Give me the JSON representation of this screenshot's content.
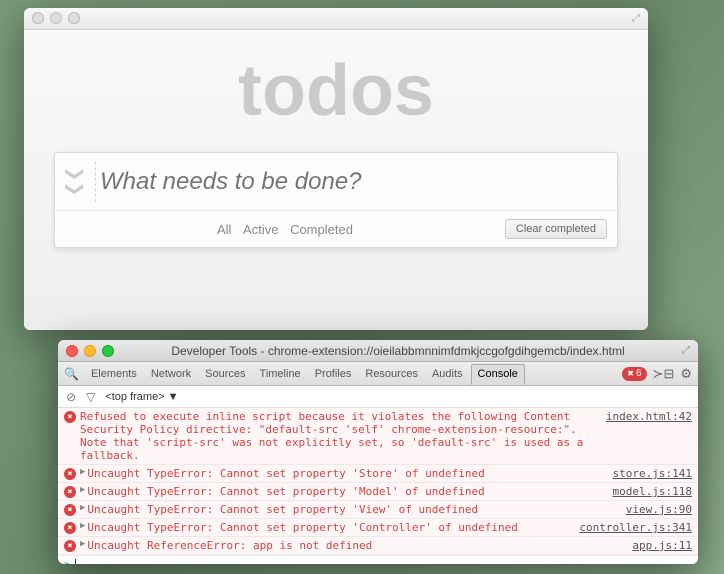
{
  "app": {
    "title": "todos",
    "placeholder": "What needs to be done?",
    "filters": {
      "all": "All",
      "active": "Active",
      "completed": "Completed"
    },
    "clear_label": "Clear completed"
  },
  "devtools": {
    "window_title": "Developer Tools - chrome-extension://oieilabbmnnimfdmkjccgofgdihgemcb/index.html",
    "tabs": {
      "elements": "Elements",
      "network": "Network",
      "sources": "Sources",
      "timeline": "Timeline",
      "profiles": "Profiles",
      "resources": "Resources",
      "audits": "Audits",
      "console": "Console"
    },
    "error_count": "6",
    "frame_selector": "<top frame> ▼",
    "errors": [
      {
        "msg": "Refused to execute inline script because it violates the following Content Security Policy directive: \"default-src 'self' chrome-extension-resource:\". Note that 'script-src' was not explicitly set, so 'default-src' is used as a fallback.",
        "src": "index.html:42",
        "expandable": false
      },
      {
        "msg": "Uncaught TypeError: Cannot set property 'Store' of undefined",
        "src": "store.js:141",
        "expandable": true
      },
      {
        "msg": "Uncaught TypeError: Cannot set property 'Model' of undefined",
        "src": "model.js:118",
        "expandable": true
      },
      {
        "msg": "Uncaught TypeError: Cannot set property 'View' of undefined",
        "src": "view.js:90",
        "expandable": true
      },
      {
        "msg": "Uncaught TypeError: Cannot set property 'Controller' of undefined",
        "src": "controller.js:341",
        "expandable": true
      },
      {
        "msg": "Uncaught ReferenceError: app is not defined",
        "src": "app.js:11",
        "expandable": true
      }
    ],
    "prompt_caret": ">"
  }
}
